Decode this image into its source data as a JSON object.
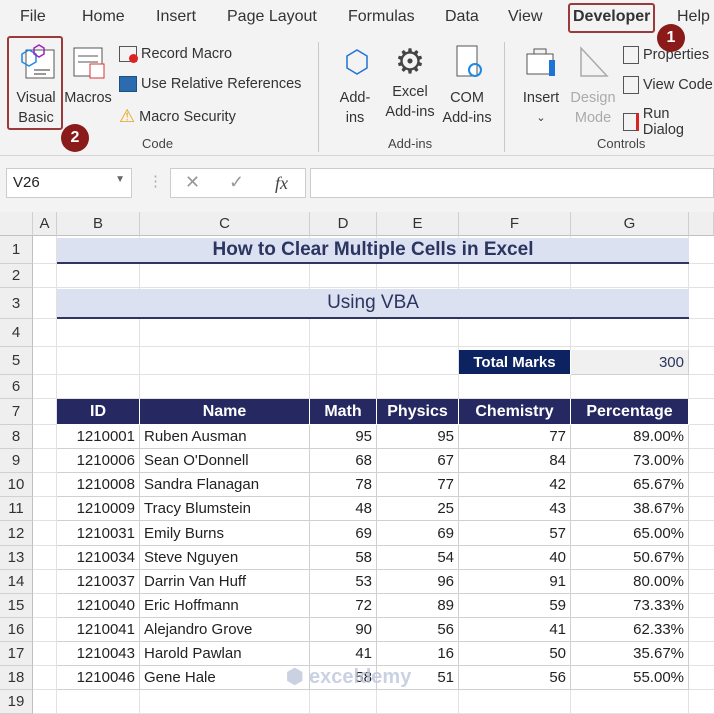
{
  "menu": [
    "File",
    "Home",
    "Insert",
    "Page Layout",
    "Formulas",
    "Data",
    "View",
    "Developer",
    "Help"
  ],
  "ribbon": {
    "visual_basic": [
      "Visual",
      "Basic"
    ],
    "macros": "Macros",
    "record_macro": "Record Macro",
    "relative_refs": "Use Relative References",
    "macro_security": "Macro Security",
    "group_code": "Code",
    "addins": [
      "Add-",
      "ins"
    ],
    "excel_addins": [
      "Excel",
      "Add-ins"
    ],
    "com_addins": [
      "COM",
      "Add-ins"
    ],
    "group_addins": "Add-ins",
    "insert": "Insert",
    "design_mode": [
      "Design",
      "Mode"
    ],
    "properties": "Properties",
    "view_code": "View Code",
    "run_dialog": "Run Dialog",
    "group_controls": "Controls",
    "badge1": "1",
    "badge2": "2"
  },
  "formula_bar": {
    "name_box": "V26",
    "fx": "fx",
    "value": ""
  },
  "columns": [
    "A",
    "B",
    "C",
    "D",
    "E",
    "F",
    "G"
  ],
  "rows": [
    "1",
    "2",
    "3",
    "4",
    "5",
    "6",
    "7",
    "8",
    "9",
    "10",
    "11",
    "12",
    "13",
    "14",
    "15",
    "16",
    "17",
    "18",
    "19"
  ],
  "sheet": {
    "title": "How to Clear Multiple Cells in Excel",
    "subtitle": "Using VBA",
    "total_label": "Total Marks",
    "total_value": "300",
    "headers": [
      "ID",
      "Name",
      "Math",
      "Physics",
      "Chemistry",
      "Percentage"
    ],
    "data": [
      [
        "1210001",
        "Ruben Ausman",
        "95",
        "95",
        "77",
        "89.00%"
      ],
      [
        "1210006",
        "Sean O'Donnell",
        "68",
        "67",
        "84",
        "73.00%"
      ],
      [
        "1210008",
        "Sandra Flanagan",
        "78",
        "77",
        "42",
        "65.67%"
      ],
      [
        "1210009",
        "Tracy Blumstein",
        "48",
        "25",
        "43",
        "38.67%"
      ],
      [
        "1210031",
        "Emily Burns",
        "69",
        "69",
        "57",
        "65.00%"
      ],
      [
        "1210034",
        "Steve Nguyen",
        "58",
        "54",
        "40",
        "50.67%"
      ],
      [
        "1210037",
        "Darrin Van Huff",
        "53",
        "96",
        "91",
        "80.00%"
      ],
      [
        "1210040",
        "Eric Hoffmann",
        "72",
        "89",
        "59",
        "73.33%"
      ],
      [
        "1210041",
        "Alejandro Grove",
        "90",
        "56",
        "41",
        "62.33%"
      ],
      [
        "1210043",
        "Harold Pawlan",
        "41",
        "16",
        "50",
        "35.67%"
      ],
      [
        "1210046",
        "Gene Hale",
        "58",
        "51",
        "56",
        "55.00%"
      ]
    ]
  },
  "watermark": "exceldemy"
}
